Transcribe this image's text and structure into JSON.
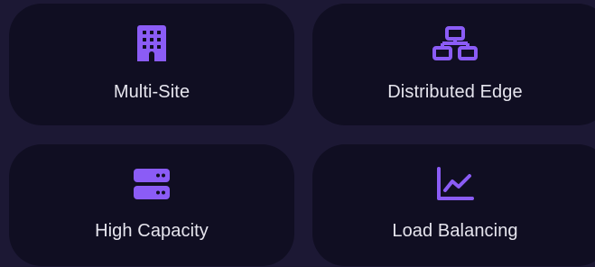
{
  "colors": {
    "background": "#1c1834",
    "card": "#100e22",
    "accent": "#8b5cf6",
    "text": "#e6e5ee"
  },
  "features": [
    {
      "label": "Multi-Site",
      "icon": "building-icon"
    },
    {
      "label": "Distributed Edge",
      "icon": "network-icon"
    },
    {
      "label": "High Capacity",
      "icon": "server-icon"
    },
    {
      "label": "Load Balancing",
      "icon": "chart-line-icon"
    }
  ]
}
